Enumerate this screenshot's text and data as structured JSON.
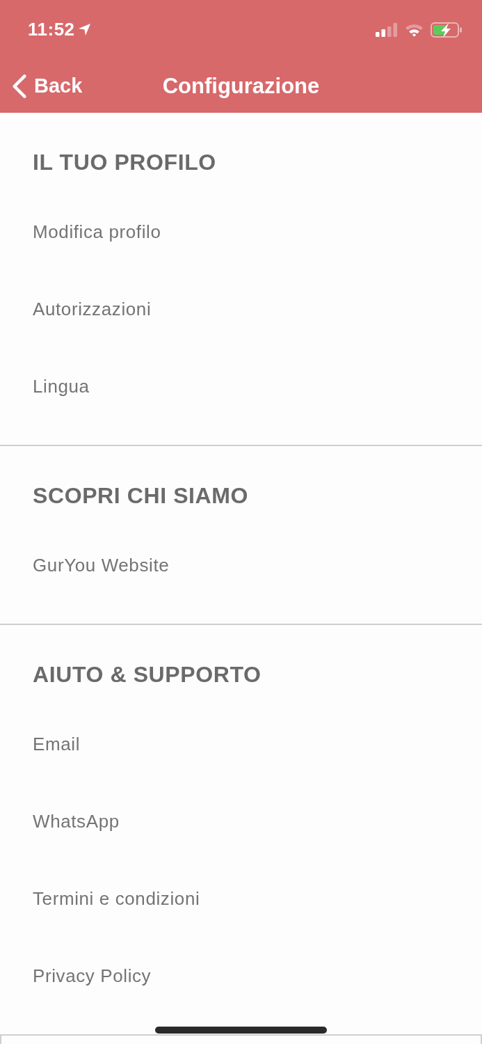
{
  "status_bar": {
    "time": "11:52"
  },
  "nav_bar": {
    "back_label": "Back",
    "title": "Configurazione"
  },
  "sections": [
    {
      "title": "IL TUO PROFILO",
      "items": [
        "Modifica profilo",
        "Autorizzazioni",
        "Lingua"
      ]
    },
    {
      "title": "SCOPRI CHI SIAMO",
      "items": [
        "GurYou Website"
      ]
    },
    {
      "title": "AIUTO & SUPPORTO",
      "items": [
        "Email",
        "WhatsApp",
        "Termini e condizioni",
        "Privacy Policy"
      ]
    }
  ]
}
